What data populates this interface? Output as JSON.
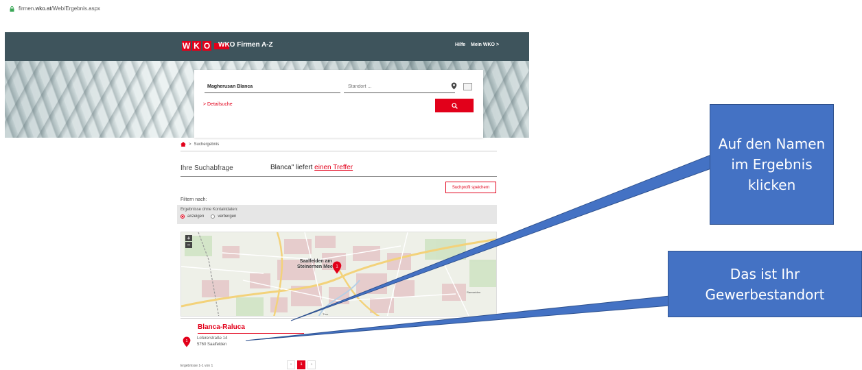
{
  "address_bar": {
    "url_prefix": "firmen.",
    "url_domain": "wko.at",
    "url_path": "/Web/Ergebnis.aspx"
  },
  "header": {
    "logo_letters": [
      "W",
      "K",
      "O"
    ],
    "title": "WKO Firmen A-Z",
    "nav_help": "Hilfe",
    "nav_mywko": "Mein WKO >"
  },
  "search": {
    "name_value": "Magherusan Blanca",
    "location_placeholder": "Standort ...",
    "detail_link": "> Detailsuche"
  },
  "breadcrumb": {
    "current": "Suchergebnis",
    "separator": ">"
  },
  "query": {
    "label": "Ihre Suchabfrage",
    "result_prefix": "Blanca\" liefert ",
    "result_hit": "einen Treffer"
  },
  "save_profile_button": "Suchprofil speichern",
  "filter": {
    "label": "Filtern nach:",
    "contact_title": "Ergebnisse ohne Kontaktdaten:",
    "option_show": "anzeigen",
    "option_hide": "verbergen",
    "selected": "anzeigen"
  },
  "map": {
    "city_line1": "Saalfelden am",
    "city_line2": "Steinernen Meer",
    "marker_number": "1",
    "label_east": "Ramseiden",
    "label_south": "Thor"
  },
  "result": {
    "number": "1",
    "name": "Blanca-Raluca",
    "street": "Lofererstraße 14",
    "city": "5760 Saalfelden"
  },
  "pagination": {
    "summary": "Ergebnisse 1-1 von 1",
    "prev": "«",
    "current": "1",
    "next": "»"
  },
  "callouts": {
    "name_hint": "Auf den Namen im Ergebnis klicken",
    "location_hint": "Das ist Ihr Gewerbestandort"
  },
  "colors": {
    "brand_red": "#e2001a",
    "header_bg": "#3e545c",
    "callout_blue": "#4472c4"
  }
}
